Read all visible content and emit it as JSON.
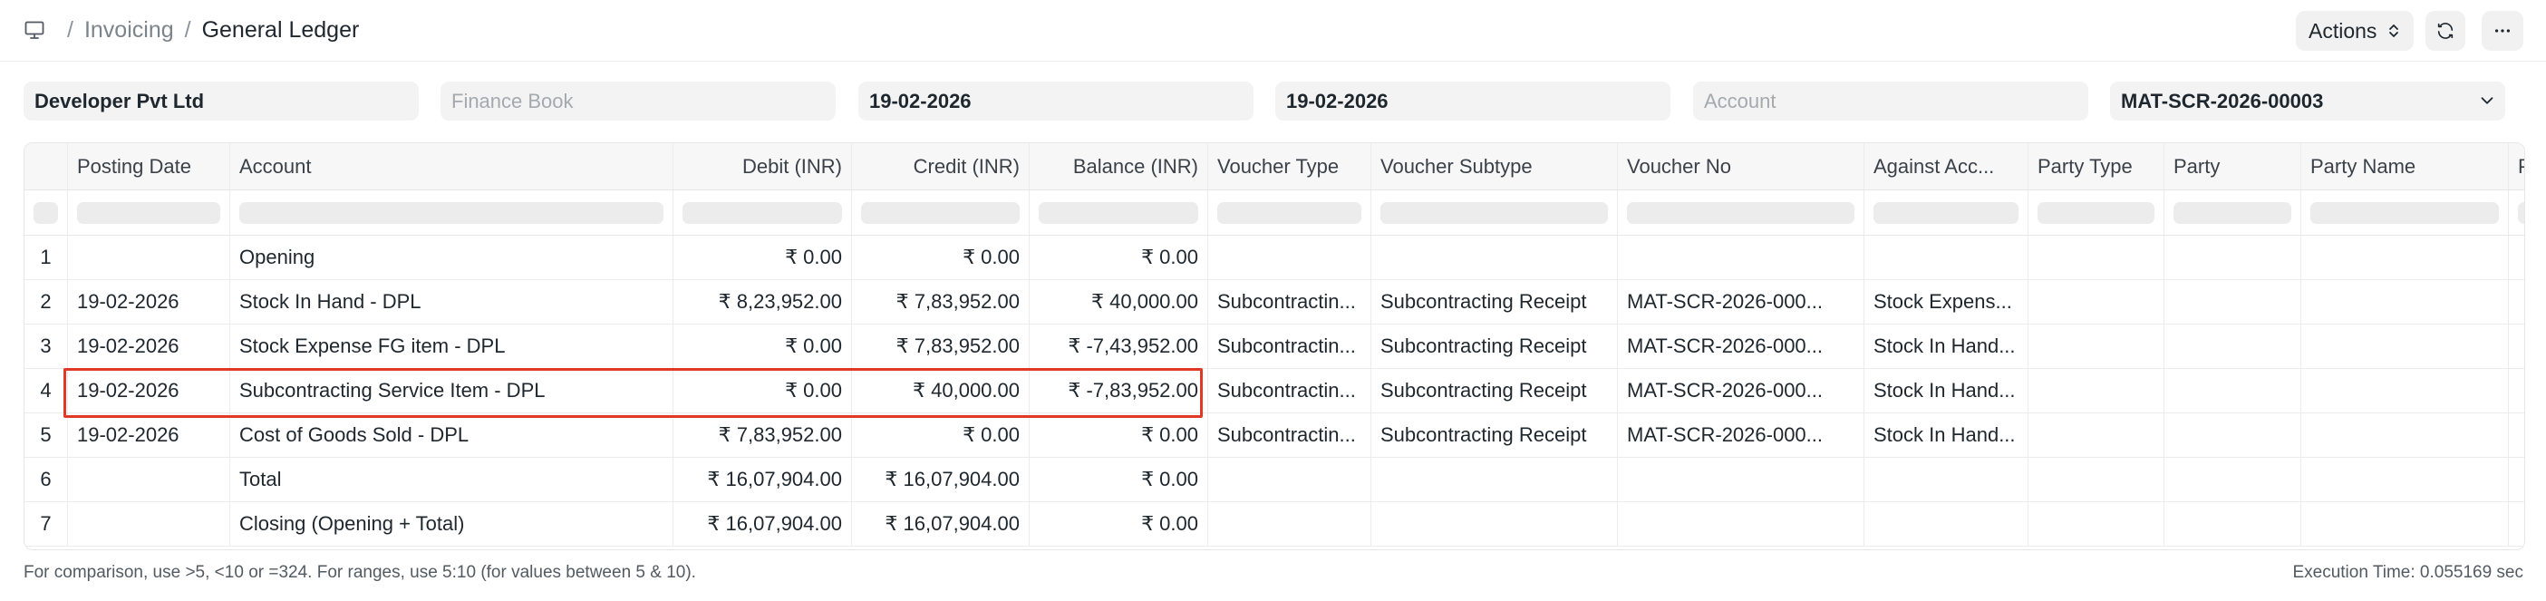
{
  "breadcrumb": {
    "items": [
      "Invoicing"
    ],
    "current": "General Ledger"
  },
  "toolbar": {
    "actions_label": "Actions"
  },
  "filters": {
    "company": "Developer Pvt Ltd",
    "finance_book_placeholder": "Finance Book",
    "from_date": "19-02-2026",
    "to_date": "19-02-2026",
    "account_placeholder": "Account",
    "voucher_no": "MAT-SCR-2026-00003"
  },
  "table": {
    "columns": [
      "Posting Date",
      "Account",
      "Debit (INR)",
      "Credit (INR)",
      "Balance (INR)",
      "Voucher Type",
      "Voucher Subtype",
      "Voucher No",
      "Against Acc...",
      "Party Type",
      "Party",
      "Party Name",
      "P"
    ],
    "rows": [
      {
        "idx": "1",
        "posting_date": "",
        "account": "Opening",
        "debit": "₹ 0.00",
        "credit": "₹ 0.00",
        "balance": "₹ 0.00",
        "voucher_type": "",
        "voucher_subtype": "",
        "voucher_no": "",
        "against_account": "",
        "party_type": "",
        "party": "",
        "party_name": ""
      },
      {
        "idx": "2",
        "posting_date": "19-02-2026",
        "account": "Stock In Hand - DPL",
        "debit": "₹ 8,23,952.00",
        "credit": "₹ 7,83,952.00",
        "balance": "₹ 40,000.00",
        "voucher_type": "Subcontractin...",
        "voucher_subtype": "Subcontracting Receipt",
        "voucher_no": "MAT-SCR-2026-000...",
        "against_account": "Stock Expens...",
        "party_type": "",
        "party": "",
        "party_name": ""
      },
      {
        "idx": "3",
        "posting_date": "19-02-2026",
        "account": "Stock Expense FG item - DPL",
        "debit": "₹ 0.00",
        "credit": "₹ 7,83,952.00",
        "balance": "₹ -7,43,952.00",
        "voucher_type": "Subcontractin...",
        "voucher_subtype": "Subcontracting Receipt",
        "voucher_no": "MAT-SCR-2026-000...",
        "against_account": "Stock In Hand...",
        "party_type": "",
        "party": "",
        "party_name": ""
      },
      {
        "idx": "4",
        "posting_date": "19-02-2026",
        "account": "Subcontracting Service Item - DPL",
        "debit": "₹ 0.00",
        "credit": "₹ 40,000.00",
        "balance": "₹ -7,83,952.00",
        "voucher_type": "Subcontractin...",
        "voucher_subtype": "Subcontracting Receipt",
        "voucher_no": "MAT-SCR-2026-000...",
        "against_account": "Stock In Hand...",
        "party_type": "",
        "party": "",
        "party_name": ""
      },
      {
        "idx": "5",
        "posting_date": "19-02-2026",
        "account": "Cost of Goods Sold - DPL",
        "debit": "₹ 7,83,952.00",
        "credit": "₹ 0.00",
        "balance": "₹ 0.00",
        "voucher_type": "Subcontractin...",
        "voucher_subtype": "Subcontracting Receipt",
        "voucher_no": "MAT-SCR-2026-000...",
        "against_account": "Stock In Hand...",
        "party_type": "",
        "party": "",
        "party_name": ""
      },
      {
        "idx": "6",
        "posting_date": "",
        "account": "Total",
        "debit": "₹ 16,07,904.00",
        "credit": "₹ 16,07,904.00",
        "balance": "₹ 0.00",
        "voucher_type": "",
        "voucher_subtype": "",
        "voucher_no": "",
        "against_account": "",
        "party_type": "",
        "party": "",
        "party_name": ""
      },
      {
        "idx": "7",
        "posting_date": "",
        "account": "Closing (Opening + Total)",
        "debit": "₹ 16,07,904.00",
        "credit": "₹ 16,07,904.00",
        "balance": "₹ 0.00",
        "voucher_type": "",
        "voucher_subtype": "",
        "voucher_no": "",
        "against_account": "",
        "party_type": "",
        "party": "",
        "party_name": ""
      }
    ]
  },
  "footer": {
    "hint": "For comparison, use >5, <10 or =324. For ranges, use 5:10 (for values between 5 & 10).",
    "execution_time": "Execution Time: 0.055169 sec"
  },
  "colors": {
    "highlight": "#e03a26",
    "header_bg": "#f7f7f7",
    "field_bg": "#f3f3f3"
  }
}
